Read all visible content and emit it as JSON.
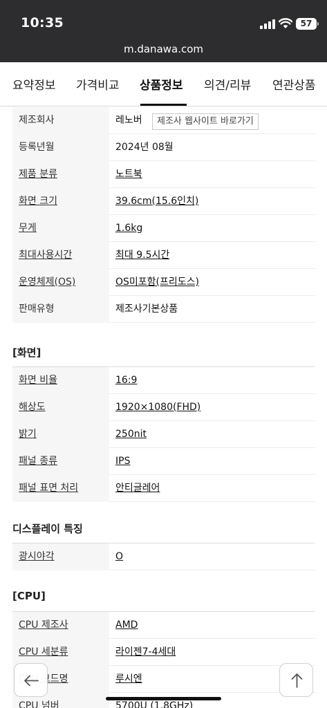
{
  "status": {
    "time": "10:35",
    "battery": "57"
  },
  "browser": {
    "url": "m.danawa.com"
  },
  "tabs": [
    {
      "label": "요약정보"
    },
    {
      "label": "가격비교"
    },
    {
      "label": "상품정보",
      "active": true
    },
    {
      "label": "의견/리뷰"
    },
    {
      "label": "연관상품"
    }
  ],
  "basic": [
    {
      "label": "제조회사",
      "value": "레노버",
      "button": "제조사 웹사이트 바로가기"
    },
    {
      "label": "등록년월",
      "value": "2024년 08월"
    },
    {
      "label": "제품 분류",
      "value": "노트북"
    },
    {
      "label": "화면 크기",
      "value": "39.6cm(15.6인치)"
    },
    {
      "label": "무게",
      "value": "1.6kg"
    },
    {
      "label": "최대사용시간",
      "value": "최대 9.5시간"
    },
    {
      "label": "운영체제(OS)",
      "value": "OS미포함(프리도스)"
    },
    {
      "label": "판매유형",
      "value": "제조사기본상품"
    }
  ],
  "screen": {
    "title": "[화면]",
    "rows": [
      {
        "label": "화면 비율",
        "value": "16:9"
      },
      {
        "label": "해상도",
        "value": "1920×1080(FHD)"
      },
      {
        "label": "밝기",
        "value": "250nit"
      },
      {
        "label": "패널 종류",
        "value": "IPS"
      },
      {
        "label": "패널 표면 처리",
        "value": "안티글레어"
      }
    ]
  },
  "display_features": {
    "title": "디스플레이 특징",
    "rows": [
      {
        "label": "광시야각",
        "value": "O"
      }
    ]
  },
  "cpu": {
    "title": "[CPU]",
    "rows": [
      {
        "label": "CPU 제조사",
        "value": "AMD"
      },
      {
        "label": "CPU 세분류",
        "value": "라이젠7-4세대"
      },
      {
        "label": "CPU 코드명",
        "value": "루시엔"
      },
      {
        "label": "CPU 넘버",
        "value": "5700U (1.8GHz)"
      }
    ]
  },
  "icons": {
    "back": "arrow-left-icon",
    "top": "arrow-up-icon"
  }
}
